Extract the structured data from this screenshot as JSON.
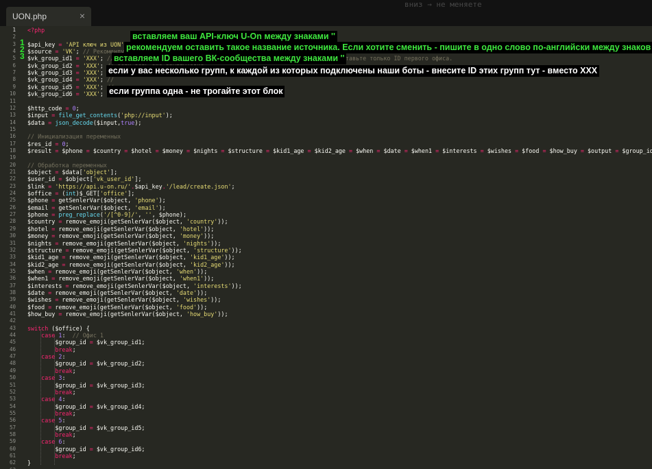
{
  "tab": {
    "title": "UON.php",
    "close": "×"
  },
  "background_text": "вниз → не меняете",
  "markers": [
    "1",
    "2",
    "3"
  ],
  "annotations": {
    "a1": "вставляем ваш API-ключ U-On между знаками ''",
    "a2": "рекомендуем оставить такое название источника. Если хотите сменить - пишите в одно слово по-английски между знаков ''",
    "a3": "вставляем ID вашего ВК-сообщества между знаками ''",
    "a4": "если у вас несколько групп, к каждой из которых подключены наши боты - внесите ID этих групп тут - вместо XXX",
    "a5": "если группа одна - не трогайте этот блок"
  },
  "lines": [
    [
      [
        "o",
        "<?php"
      ]
    ],
    [],
    [
      [
        "v",
        "$api_key "
      ],
      [
        "o",
        "="
      ],
      [
        "v",
        " "
      ],
      [
        "s",
        "'API ключ из UON'"
      ],
      [
        "v",
        "; "
      ],
      [
        "c",
        "// ..."
      ]
    ],
    [
      [
        "v",
        "$source "
      ],
      [
        "o",
        "="
      ],
      [
        "v",
        " "
      ],
      [
        "s",
        "'VK'"
      ],
      [
        "v",
        "; "
      ],
      [
        "c",
        "// Рекомендуем"
      ]
    ],
    [
      [
        "v",
        "$vk_group_id1 "
      ],
      [
        "o",
        "="
      ],
      [
        "v",
        " "
      ],
      [
        "s",
        "'XXX'"
      ],
      [
        "v",
        "; "
      ],
      [
        "c",
        "// ID группы ВКонтакте. ID (внутри U-ON). Если у вас один офис, то вставьте только ID первого офиса."
      ]
    ],
    [
      [
        "v",
        "$vk_group_id2 "
      ],
      [
        "o",
        "="
      ],
      [
        "v",
        " "
      ],
      [
        "s",
        "'XXX'"
      ],
      [
        "v",
        "; "
      ],
      [
        "c",
        "// если есть еще группы/офис"
      ]
    ],
    [
      [
        "v",
        "$vk_group_id3 "
      ],
      [
        "o",
        "="
      ],
      [
        "v",
        " "
      ],
      [
        "s",
        "'XXX'"
      ],
      [
        "v",
        "; "
      ],
      [
        "c",
        "//"
      ]
    ],
    [
      [
        "v",
        "$vk_group_id4 "
      ],
      [
        "o",
        "="
      ],
      [
        "v",
        " "
      ],
      [
        "s",
        "'XXX'"
      ],
      [
        "v",
        "; "
      ],
      [
        "c",
        "//"
      ]
    ],
    [
      [
        "v",
        "$vk_group_id5 "
      ],
      [
        "o",
        "="
      ],
      [
        "v",
        " "
      ],
      [
        "s",
        "'XXX'"
      ],
      [
        "v",
        "; "
      ],
      [
        "c",
        "//"
      ]
    ],
    [
      [
        "v",
        "$vk_group_id6 "
      ],
      [
        "o",
        "="
      ],
      [
        "v",
        " "
      ],
      [
        "s",
        "'XXX'"
      ],
      [
        "v",
        "; "
      ],
      [
        "c",
        "//"
      ]
    ],
    [],
    [
      [
        "v",
        "$http_code "
      ],
      [
        "o",
        "="
      ],
      [
        "v",
        " "
      ],
      [
        "n",
        "0"
      ],
      [
        "v",
        ";"
      ]
    ],
    [
      [
        "v",
        "$input "
      ],
      [
        "o",
        "="
      ],
      [
        "v",
        " "
      ],
      [
        "f",
        "file_get_contents"
      ],
      [
        "v",
        "("
      ],
      [
        "s",
        "'php://input'"
      ],
      [
        "v",
        ");"
      ]
    ],
    [
      [
        "v",
        "$data "
      ],
      [
        "o",
        "="
      ],
      [
        "v",
        " "
      ],
      [
        "f",
        "json_decode"
      ],
      [
        "v",
        "($input,"
      ],
      [
        "n",
        "true"
      ],
      [
        "v",
        ");"
      ]
    ],
    [],
    [
      [
        "c",
        "// Инициализация переменных"
      ]
    ],
    [
      [
        "v",
        "$res_id "
      ],
      [
        "o",
        "="
      ],
      [
        "v",
        " "
      ],
      [
        "n",
        "0"
      ],
      [
        "v",
        ";"
      ]
    ],
    [
      [
        "v",
        "$result "
      ],
      [
        "o",
        "="
      ],
      [
        "v",
        " $phone "
      ],
      [
        "o",
        "="
      ],
      [
        "v",
        " $country "
      ],
      [
        "o",
        "="
      ],
      [
        "v",
        " $hotel "
      ],
      [
        "o",
        "="
      ],
      [
        "v",
        " $money "
      ],
      [
        "o",
        "="
      ],
      [
        "v",
        " $nights "
      ],
      [
        "o",
        "="
      ],
      [
        "v",
        " $structure "
      ],
      [
        "o",
        "="
      ],
      [
        "v",
        " $kid1_age "
      ],
      [
        "o",
        "="
      ],
      [
        "v",
        " $kid2_age "
      ],
      [
        "o",
        "="
      ],
      [
        "v",
        " $when "
      ],
      [
        "o",
        "="
      ],
      [
        "v",
        " $date "
      ],
      [
        "o",
        "="
      ],
      [
        "v",
        " $when1 "
      ],
      [
        "o",
        "="
      ],
      [
        "v",
        " $interests "
      ],
      [
        "o",
        "="
      ],
      [
        "v",
        " $wishes "
      ],
      [
        "o",
        "="
      ],
      [
        "v",
        " $food "
      ],
      [
        "o",
        "="
      ],
      [
        "v",
        " $how_buy "
      ],
      [
        "o",
        "="
      ],
      [
        "v",
        " $output "
      ],
      [
        "o",
        "="
      ],
      [
        "v",
        " $group_id "
      ],
      [
        "o",
        "="
      ],
      [
        "v",
        " "
      ],
      [
        "s",
        "''"
      ],
      [
        "v",
        ";"
      ]
    ],
    [],
    [
      [
        "c",
        "// Обработка переменных"
      ]
    ],
    [
      [
        "v",
        "$object "
      ],
      [
        "o",
        "="
      ],
      [
        "v",
        " $data["
      ],
      [
        "s",
        "'object'"
      ],
      [
        "v",
        "];"
      ]
    ],
    [
      [
        "v",
        "$user_id "
      ],
      [
        "o",
        "="
      ],
      [
        "v",
        " $object["
      ],
      [
        "s",
        "'vk_user_id'"
      ],
      [
        "v",
        "];"
      ]
    ],
    [
      [
        "v",
        "$link "
      ],
      [
        "o",
        "="
      ],
      [
        "v",
        " "
      ],
      [
        "s",
        "'https://api.u-on.ru/'"
      ],
      [
        "o",
        "."
      ],
      [
        "v",
        "$api_key"
      ],
      [
        "o",
        "."
      ],
      [
        "s",
        "'/lead/create.json'"
      ],
      [
        "v",
        ";"
      ]
    ],
    [
      [
        "v",
        "$office "
      ],
      [
        "o",
        "="
      ],
      [
        "v",
        " ("
      ],
      [
        "f",
        "int"
      ],
      [
        "v",
        ")$_GET["
      ],
      [
        "s",
        "'office'"
      ],
      [
        "v",
        "];"
      ]
    ],
    [
      [
        "v",
        "$phone "
      ],
      [
        "o",
        "="
      ],
      [
        "v",
        " getSenlerVar($object, "
      ],
      [
        "s",
        "'phone'"
      ],
      [
        "v",
        ");"
      ]
    ],
    [
      [
        "v",
        "$email "
      ],
      [
        "o",
        "="
      ],
      [
        "v",
        " getSenlerVar($object, "
      ],
      [
        "s",
        "'email'"
      ],
      [
        "v",
        ");"
      ]
    ],
    [
      [
        "v",
        "$phone "
      ],
      [
        "o",
        "="
      ],
      [
        "v",
        " "
      ],
      [
        "f",
        "preg_replace"
      ],
      [
        "v",
        "("
      ],
      [
        "s",
        "'/[^0-9]/'"
      ],
      [
        "v",
        ", "
      ],
      [
        "s",
        "''"
      ],
      [
        "v",
        ", $phone);"
      ]
    ],
    [
      [
        "v",
        "$country "
      ],
      [
        "o",
        "="
      ],
      [
        "v",
        " remove_emoji(getSenlerVar($object, "
      ],
      [
        "s",
        "'country'"
      ],
      [
        "v",
        "));"
      ]
    ],
    [
      [
        "v",
        "$hotel "
      ],
      [
        "o",
        "="
      ],
      [
        "v",
        " remove_emoji(getSenlerVar($object, "
      ],
      [
        "s",
        "'hotel'"
      ],
      [
        "v",
        "));"
      ]
    ],
    [
      [
        "v",
        "$money "
      ],
      [
        "o",
        "="
      ],
      [
        "v",
        " remove_emoji(getSenlerVar($object, "
      ],
      [
        "s",
        "'money'"
      ],
      [
        "v",
        "));"
      ]
    ],
    [
      [
        "v",
        "$nights "
      ],
      [
        "o",
        "="
      ],
      [
        "v",
        " remove_emoji(getSenlerVar($object, "
      ],
      [
        "s",
        "'nights'"
      ],
      [
        "v",
        "));"
      ]
    ],
    [
      [
        "v",
        "$structure "
      ],
      [
        "o",
        "="
      ],
      [
        "v",
        " remove_emoji(getSenlerVar($object, "
      ],
      [
        "s",
        "'structure'"
      ],
      [
        "v",
        "));"
      ]
    ],
    [
      [
        "v",
        "$kid1_age "
      ],
      [
        "o",
        "="
      ],
      [
        "v",
        " remove_emoji(getSenlerVar($object, "
      ],
      [
        "s",
        "'kid1_age'"
      ],
      [
        "v",
        "));"
      ]
    ],
    [
      [
        "v",
        "$kid2_age "
      ],
      [
        "o",
        "="
      ],
      [
        "v",
        " remove_emoji(getSenlerVar($object, "
      ],
      [
        "s",
        "'kid2_age'"
      ],
      [
        "v",
        "));"
      ]
    ],
    [
      [
        "v",
        "$when "
      ],
      [
        "o",
        "="
      ],
      [
        "v",
        " remove_emoji(getSenlerVar($object, "
      ],
      [
        "s",
        "'when'"
      ],
      [
        "v",
        "));"
      ]
    ],
    [
      [
        "v",
        "$when1 "
      ],
      [
        "o",
        "="
      ],
      [
        "v",
        " remove_emoji(getSenlerVar($object, "
      ],
      [
        "s",
        "'when1'"
      ],
      [
        "v",
        "));"
      ]
    ],
    [
      [
        "v",
        "$interests "
      ],
      [
        "o",
        "="
      ],
      [
        "v",
        " remove_emoji(getSenlerVar($object, "
      ],
      [
        "s",
        "'interests'"
      ],
      [
        "v",
        "));"
      ]
    ],
    [
      [
        "v",
        "$date "
      ],
      [
        "o",
        "="
      ],
      [
        "v",
        " remove_emoji(getSenlerVar($object, "
      ],
      [
        "s",
        "'date'"
      ],
      [
        "v",
        "));"
      ]
    ],
    [
      [
        "v",
        "$wishes "
      ],
      [
        "o",
        "="
      ],
      [
        "v",
        " remove_emoji(getSenlerVar($object, "
      ],
      [
        "s",
        "'wishes'"
      ],
      [
        "v",
        "));"
      ]
    ],
    [
      [
        "v",
        "$food "
      ],
      [
        "o",
        "="
      ],
      [
        "v",
        " remove_emoji(getSenlerVar($object, "
      ],
      [
        "s",
        "'food'"
      ],
      [
        "v",
        "));"
      ]
    ],
    [
      [
        "v",
        "$how_buy "
      ],
      [
        "o",
        "="
      ],
      [
        "v",
        " remove_emoji(getSenlerVar($object, "
      ],
      [
        "s",
        "'how_buy'"
      ],
      [
        "v",
        "));"
      ]
    ],
    [],
    [
      [
        "o",
        "switch"
      ],
      [
        "v",
        " ($office) {"
      ]
    ],
    [
      [
        "v",
        "    "
      ],
      [
        "o",
        "case"
      ],
      [
        "v",
        " "
      ],
      [
        "n",
        "1"
      ],
      [
        "v",
        ":  "
      ],
      [
        "c",
        "// Офис 1"
      ]
    ],
    [
      [
        "v",
        "        $group_id "
      ],
      [
        "o",
        "="
      ],
      [
        "v",
        " $vk_group_id1;"
      ]
    ],
    [
      [
        "v",
        "        "
      ],
      [
        "o",
        "break"
      ],
      [
        "v",
        ";"
      ]
    ],
    [
      [
        "v",
        "    "
      ],
      [
        "o",
        "case"
      ],
      [
        "v",
        " "
      ],
      [
        "n",
        "2"
      ],
      [
        "v",
        ":"
      ]
    ],
    [
      [
        "v",
        "        $group_id "
      ],
      [
        "o",
        "="
      ],
      [
        "v",
        " $vk_group_id2;"
      ]
    ],
    [
      [
        "v",
        "        "
      ],
      [
        "o",
        "break"
      ],
      [
        "v",
        ";"
      ]
    ],
    [
      [
        "v",
        "    "
      ],
      [
        "o",
        "case"
      ],
      [
        "v",
        " "
      ],
      [
        "n",
        "3"
      ],
      [
        "v",
        ":"
      ]
    ],
    [
      [
        "v",
        "        $group_id "
      ],
      [
        "o",
        "="
      ],
      [
        "v",
        " $vk_group_id3;"
      ]
    ],
    [
      [
        "v",
        "        "
      ],
      [
        "o",
        "break"
      ],
      [
        "v",
        ";"
      ]
    ],
    [
      [
        "v",
        "    "
      ],
      [
        "o",
        "case"
      ],
      [
        "v",
        " "
      ],
      [
        "n",
        "4"
      ],
      [
        "v",
        ":"
      ]
    ],
    [
      [
        "v",
        "        $group_id "
      ],
      [
        "o",
        "="
      ],
      [
        "v",
        " $vk_group_id4;"
      ]
    ],
    [
      [
        "v",
        "        "
      ],
      [
        "o",
        "break"
      ],
      [
        "v",
        ";"
      ]
    ],
    [
      [
        "v",
        "    "
      ],
      [
        "o",
        "case"
      ],
      [
        "v",
        " "
      ],
      [
        "n",
        "5"
      ],
      [
        "v",
        ":"
      ]
    ],
    [
      [
        "v",
        "        $group_id "
      ],
      [
        "o",
        "="
      ],
      [
        "v",
        " $vk_group_id5;"
      ]
    ],
    [
      [
        "v",
        "        "
      ],
      [
        "o",
        "break"
      ],
      [
        "v",
        ";"
      ]
    ],
    [
      [
        "v",
        "    "
      ],
      [
        "o",
        "case"
      ],
      [
        "v",
        " "
      ],
      [
        "n",
        "6"
      ],
      [
        "v",
        ":"
      ]
    ],
    [
      [
        "v",
        "        $group_id "
      ],
      [
        "o",
        "="
      ],
      [
        "v",
        " $vk_group_id6;"
      ]
    ],
    [
      [
        "v",
        "        "
      ],
      [
        "o",
        "break"
      ],
      [
        "v",
        ";"
      ]
    ],
    [
      [
        "v",
        "}"
      ]
    ],
    []
  ]
}
